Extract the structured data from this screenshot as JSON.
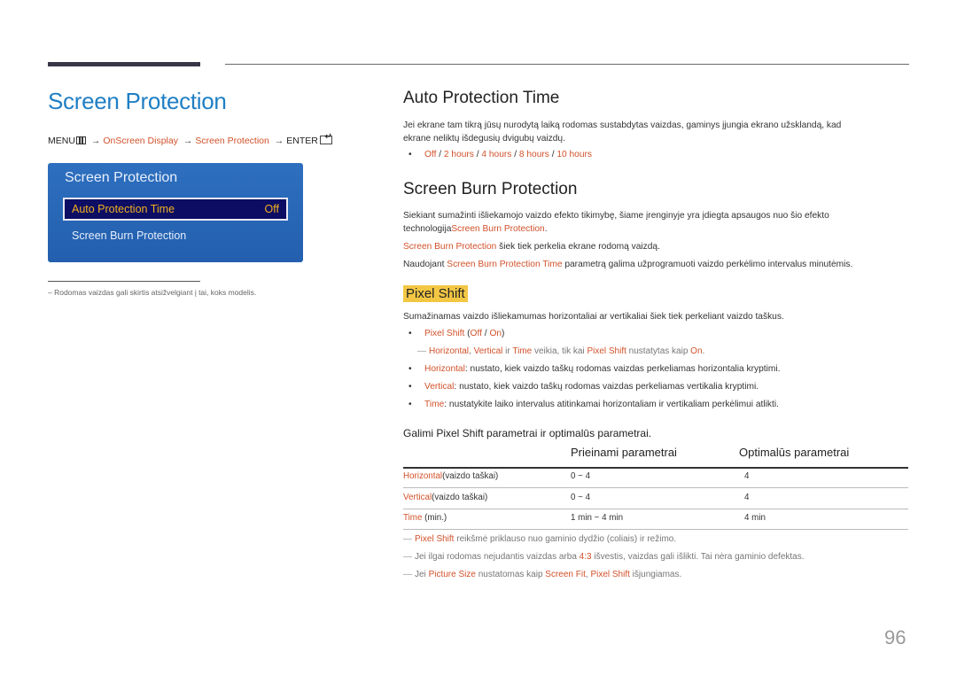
{
  "page": {
    "title": "Screen Protection",
    "page_number": "96"
  },
  "breadcrumb": {
    "menu_label": "MENU",
    "step1": "OnScreen Display",
    "step2": "Screen Protection",
    "enter_label": "ENTER",
    "arrow": "→"
  },
  "osd_menu": {
    "title": "Screen Protection",
    "items": [
      {
        "label": "Auto Protection Time",
        "value": "Off",
        "selected": true
      },
      {
        "label": "Screen Burn Protection",
        "value": "",
        "selected": false
      }
    ]
  },
  "left_footnote": "–  Rodomas vaizdas gali skirtis atsižvelgiant į tai, koks modelis.",
  "auto_protection": {
    "heading": "Auto Protection Time",
    "desc_line1": "Jei ekrane tam tikrą jūsų nurodytą laiką rodomas sustabdytas vaizdas, gaminys įjungia ekrano užsklandą, kad",
    "desc_line2": "ekrane neliktų išdegusių dvigubų vaizdų.",
    "options": [
      "Off",
      "2 hours",
      "4 hours",
      "8 hours",
      "10 hours"
    ],
    "separator": " / "
  },
  "screen_burn": {
    "heading": "Screen Burn Protection",
    "p1_line1": "Siekiant sumažinti išliekamojo vaizdo efekto tikimybę, šiame įrenginyje yra įdiegta apsaugos nuo šio efekto",
    "p1_line2_prefix": "technologija",
    "p1_line2_link": "Screen Burn Protection",
    "p1_line2_suffix": ".",
    "p2_link": "Screen Burn Protection",
    "p2_text": " šiek tiek perkelia ekrane rodomą vaizdą.",
    "p3_prefix": "Naudojant ",
    "p3_link": "Screen Burn Protection Time",
    "p3_suffix": " parametrą galima užprogramuoti vaizdo perkėlimo intervalus minutėmis."
  },
  "pixel_shift": {
    "heading": "Pixel Shift",
    "desc": "Sumažinamas vaizdo išliekamumas horizontaliai ar vertikaliai šiek tiek perkeliant vaizdo taškus.",
    "option_name": "Pixel Shift",
    "option_open": " (",
    "option_off": "Off",
    "option_sep": " / ",
    "option_on": "On",
    "option_close": ")",
    "subnote": {
      "horizontal": "Horizontal",
      "comma": ", ",
      "vertical": "Vertical",
      "ir": " ir ",
      "time": "Time",
      "mid": " veikia, tik kai ",
      "pixel_shift": "Pixel Shift",
      "end": " nustatytas kaip ",
      "on": "On",
      "period": "."
    },
    "bullets": [
      {
        "term": "Horizontal",
        "text": ": nustato, kiek vaizdo taškų rodomas vaizdas perkeliamas horizontalia kryptimi."
      },
      {
        "term": "Vertical",
        "text": ": nustato, kiek vaizdo taškų rodomas vaizdas perkeliamas vertikalia kryptimi."
      },
      {
        "term": "Time",
        "text": ": nustatykite laiko intervalus atitinkamai horizontaliam ir vertikaliam perkėlimui atlikti."
      }
    ],
    "table_caption": "Galimi Pixel Shift parametrai ir optimalūs parametrai."
  },
  "table": {
    "headers": [
      "",
      "Prieinami parametrai",
      "Optimalūs parametrai"
    ],
    "rows": [
      {
        "term": "Horizontal",
        "unit": "(vaizdo taškai)",
        "available": "0 ~ 4",
        "optimal": "4"
      },
      {
        "term": "Vertical",
        "unit": "(vaizdo taškai)",
        "available": "0 ~ 4",
        "optimal": "4"
      },
      {
        "term": "Time",
        "unit": " (min.)",
        "available": "1 min ~ 4 min",
        "optimal": "4 min"
      }
    ]
  },
  "notes": {
    "n1_link": "Pixel Shift",
    "n1_text": " reikšmė priklauso nuo gaminio dydžio (coliais) ir režimo.",
    "n2_prefix": "Jei ilgai rodomas nejudantis vaizdas arba ",
    "n2_link": "4:3",
    "n2_suffix": " išvestis, vaizdas gali išlikti. Tai nėra gaminio defektas.",
    "n3_prefix": "Jei ",
    "n3_link1": "Picture Size",
    "n3_mid": " nustatomas kaip ",
    "n3_link2": "Screen Fit",
    "n3_comma": ", ",
    "n3_link3": "Pixel Shift",
    "n3_suffix": " išjungiamas.",
    "dash": "―"
  },
  "colors": {
    "title_blue": "#1f7fc4",
    "link_orange": "#d2512a",
    "osd_blue": "#2e6fbf",
    "osd_selected_bg": "#0c0d63",
    "osd_selected_text": "#f0b020",
    "highlight_yellow": "#f3c744"
  }
}
